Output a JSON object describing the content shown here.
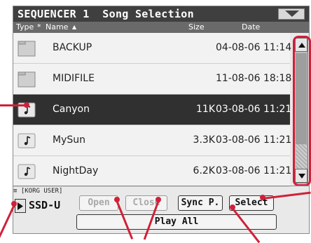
{
  "window": {
    "title": "SEQUENCER 1  Song Selection"
  },
  "columns": {
    "type": "Type",
    "sort_marker": "*",
    "name": "Name",
    "size": "Size",
    "date": "Date"
  },
  "files": [
    {
      "name": "BACKUP",
      "size": "",
      "date": "04-08-06 11:14",
      "kind": "folder-icon",
      "selected": false
    },
    {
      "name": "MIDIFILE",
      "size": "",
      "date": "11-08-06 18:18",
      "kind": "folder-icon",
      "selected": false
    },
    {
      "name": "Canyon",
      "size": "11K",
      "date": "03-08-06 11:21",
      "kind": "song-file-icon",
      "selected": true
    },
    {
      "name": "MySun",
      "size": "3.3K",
      "date": "03-08-06 11:21",
      "kind": "song-file-icon",
      "selected": false
    },
    {
      "name": "NightDay",
      "size": "6.2K",
      "date": "03-08-06 11:21",
      "kind": "song-file-icon",
      "selected": false
    }
  ],
  "location": {
    "path": "≡ [KORG USER]",
    "device": "SSD-U"
  },
  "buttons": {
    "open": "Open",
    "close": "Close",
    "sync": "Sync P.",
    "select": "Select",
    "play_all": "Play All"
  },
  "colors": {
    "title_bg": "#3f3f3f",
    "selected_row": "#303030",
    "callout": "#d0203a"
  }
}
